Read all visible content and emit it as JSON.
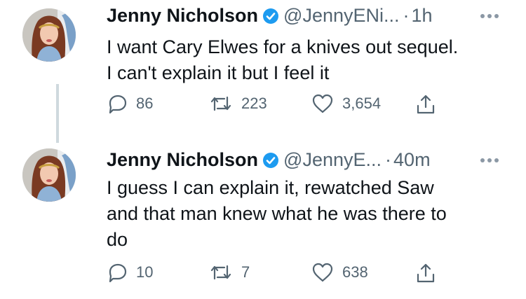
{
  "tweets": [
    {
      "author_name": "Jenny Nicholson",
      "handle": "@JennyENi...",
      "separator": "·",
      "time": "1h",
      "text_line1": "I want Cary Elwes for a knives out sequel.",
      "text_line2": "I can't explain it but I feel it",
      "text_line3": "",
      "replies": "86",
      "retweets": "223",
      "likes": "3,654"
    },
    {
      "author_name": "Jenny Nicholson",
      "handle": "@JennyE...",
      "separator": "·",
      "time": "40m",
      "text_line1": "I guess I can explain it, rewatched Saw",
      "text_line2": "and that man knew what he was there to",
      "text_line3": "do",
      "replies": "10",
      "retweets": "7",
      "likes": "638"
    }
  ],
  "icons": {
    "reply": "reply-icon",
    "retweet": "retweet-icon",
    "like": "heart-icon",
    "share": "share-icon",
    "verified": "verified-badge-icon",
    "more": "more-icon"
  },
  "colors": {
    "text": "#0f1419",
    "secondary": "#536471",
    "verified": "#1d9bf0",
    "thread_line": "#cfd9de"
  }
}
